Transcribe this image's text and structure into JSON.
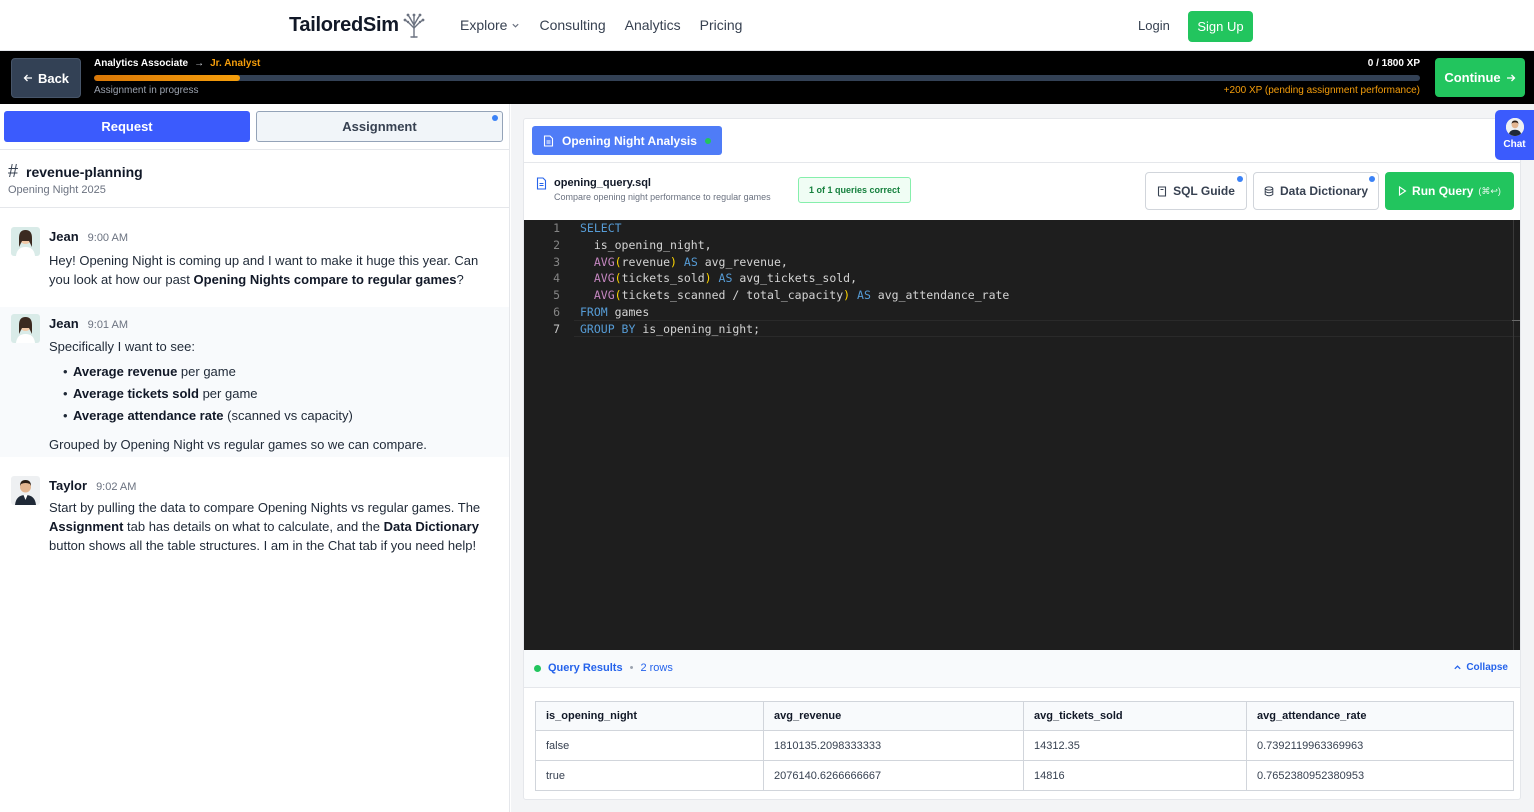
{
  "nav": {
    "brand": "TailoredSim",
    "links": [
      "Explore",
      "Consulting",
      "Analytics",
      "Pricing"
    ],
    "login": "Login",
    "signup": "Sign Up"
  },
  "progress": {
    "back": "Back",
    "current_role": "Analytics Associate",
    "arrow": "→",
    "next_role": "Jr. Analyst",
    "xp": "0 / 1800 XP",
    "fill_fraction": 0.11,
    "status": "Assignment in progress",
    "pending": "+200 XP (pending assignment performance)",
    "continue": "Continue"
  },
  "left": {
    "tabs": {
      "request": "Request",
      "assignment": "Assignment"
    },
    "channel": {
      "hash": "#",
      "name": "revenue-planning",
      "subtitle": "Opening Night 2025"
    },
    "messages": [
      {
        "name": "Jean",
        "time": "9:00 AM",
        "text_a": "Hey! Opening Night is coming up and I want to make it huge this year. Can you look at how our past ",
        "bold_a": "Opening Nights compare to regular games",
        "text_b": "?"
      },
      {
        "name": "Jean",
        "time": "9:01 AM",
        "intro": "Specifically I want to see:",
        "bullets": [
          {
            "bold": "Average revenue",
            "rest": " per game"
          },
          {
            "bold": "Average tickets sold",
            "rest": " per game"
          },
          {
            "bold": "Average attendance rate",
            "rest": " (scanned vs capacity)"
          }
        ],
        "outro": "Grouped by Opening Night vs regular games so we can compare."
      },
      {
        "name": "Taylor",
        "time": "9:02 AM",
        "t1": "Start by pulling the data to compare Opening Nights vs regular games. The ",
        "b1": "Assignment",
        "t2": " tab has details on what to calculate, and the ",
        "b2": "Data Dictionary",
        "t3": " button shows all the table structures. I am in the Chat tab if you need help!"
      }
    ]
  },
  "right": {
    "doc_tab": "Opening Night Analysis",
    "file_name": "opening_query.sql",
    "file_desc": "Compare opening night performance to regular games",
    "badge": "1 of 1 queries correct",
    "sql_guide": "SQL Guide",
    "data_dictionary": "Data Dictionary",
    "run_query": "Run Query",
    "run_shortcut": "(⌘↩)",
    "line_numbers": [
      "1",
      "2",
      "3",
      "4",
      "5",
      "6",
      "7"
    ],
    "results": {
      "title": "Query Results",
      "sep": "•",
      "rows_label": "2 rows",
      "collapse": "Collapse",
      "columns": [
        "is_opening_night",
        "avg_revenue",
        "avg_tickets_sold",
        "avg_attendance_rate"
      ],
      "rows": [
        [
          "false",
          "1810135.2098333333",
          "14312.35",
          "0.7392119963369963"
        ],
        [
          "true",
          "2076140.6266666667",
          "14816",
          "0.7652380952380953"
        ]
      ]
    }
  },
  "chat_float": "Chat"
}
